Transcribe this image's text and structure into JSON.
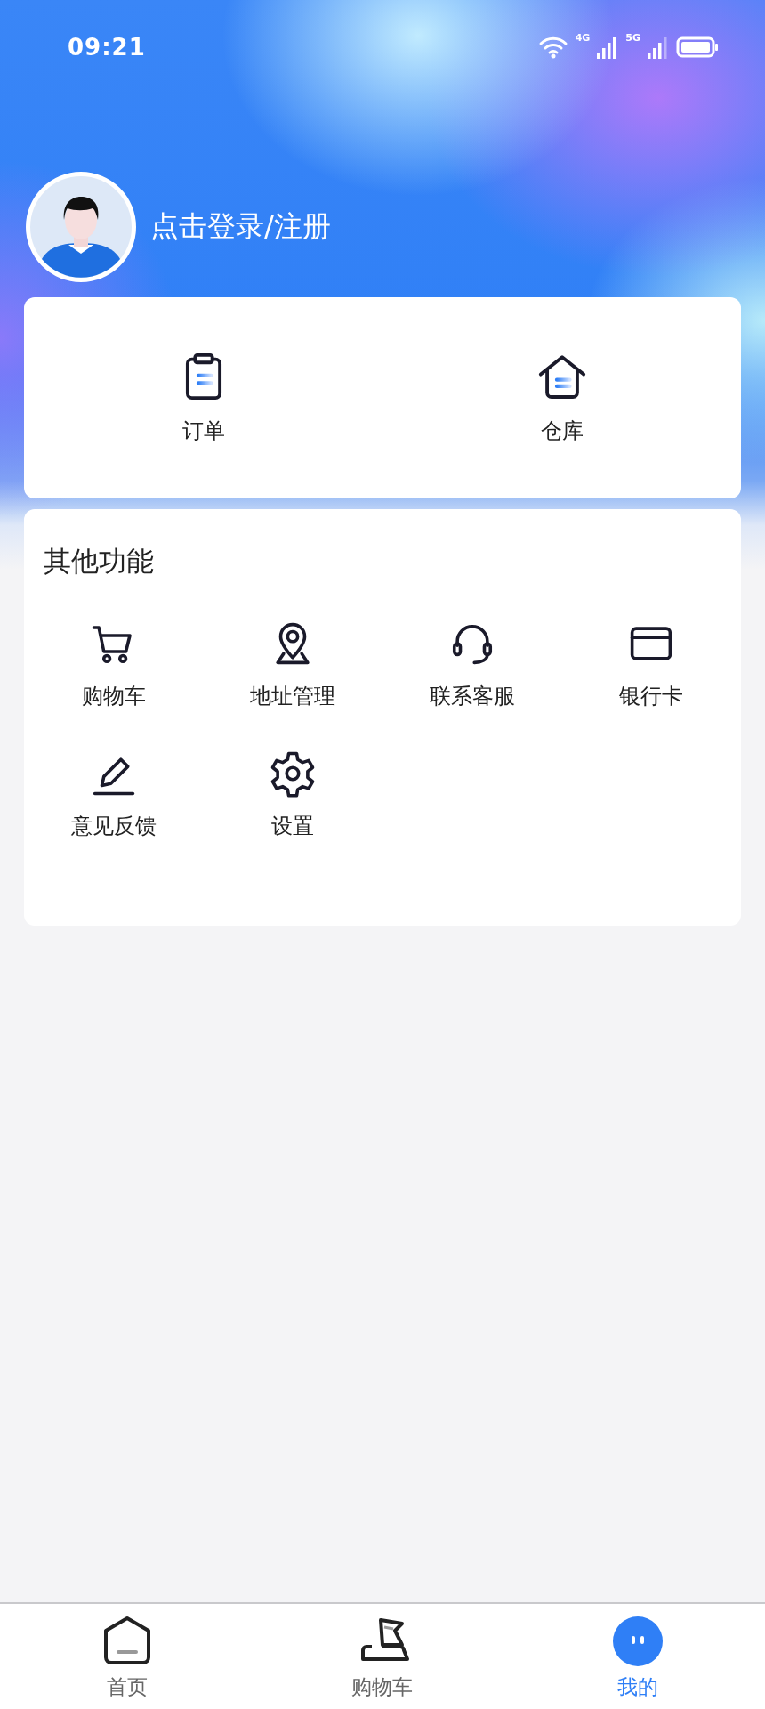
{
  "status_bar": {
    "time": "09:21",
    "networks": [
      "4G",
      "5G"
    ]
  },
  "profile": {
    "login_text": "点击登录/注册"
  },
  "main_shortcuts": [
    {
      "kind": "order",
      "label": "订单"
    },
    {
      "kind": "warehouse",
      "label": "仓库"
    }
  ],
  "other_functions": {
    "title": "其他功能",
    "items": [
      {
        "kind": "cart",
        "label": "购物车"
      },
      {
        "kind": "location",
        "label": "地址管理"
      },
      {
        "kind": "headset",
        "label": "联系客服"
      },
      {
        "kind": "card",
        "label": "银行卡"
      },
      {
        "kind": "edit",
        "label": "意见反馈"
      },
      {
        "kind": "gear",
        "label": "设置"
      }
    ]
  },
  "tab_bar": [
    {
      "kind": "home",
      "label": "首页",
      "selected": false
    },
    {
      "kind": "cart",
      "label": "购物车",
      "selected": false
    },
    {
      "kind": "profile",
      "label": "我的",
      "selected": true
    }
  ]
}
